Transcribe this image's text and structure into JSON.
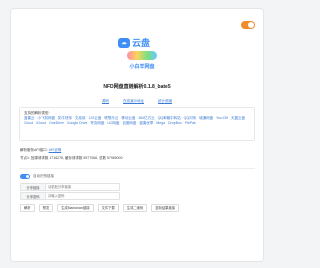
{
  "logo": {
    "brand": "云盘",
    "tagline": "小白羊网盘"
  },
  "title": "NFD网盘直链解析0.1.8_bate5",
  "links": [
    "源码",
    "在线演示地址",
    "统计频道"
  ],
  "sites": {
    "header": "支持的解析类型:",
    "items": [
      "蓝奏云",
      "小飞机网盘",
      "奶牛快传",
      "文叔叔",
      "123云盘",
      "联想乐云",
      "移动云盘",
      "360亿方云",
      "QQ邮箱中转站",
      "QQ闪传",
      "城通网盘",
      "Yun139",
      "天翼云盘",
      "Cloud",
      "iCloud",
      "OneDrive",
      "Google Drive",
      "夸克网盘",
      "UC网盘",
      "百度网盘",
      "蓝奏优享",
      "Mega",
      "DropBox",
      "PikPak"
    ]
  },
  "api": {
    "prefix": "解析服务API接口: ",
    "link": "API说明"
  },
  "stats": "节点1: 回源请求数 1716278, 缓存请求数 5577066, 总数 57969000",
  "switch_label": "自动识别链接",
  "fields": {
    "share_label": "分享链接",
    "share_placeholder": "请粘贴分享链接",
    "pwd_label": "分享密码",
    "pwd_placeholder": "请输入密码"
  },
  "buttons": [
    "解析",
    "预览",
    "生成Markdown链接",
    "文件下载",
    "生成二维码",
    "复制结果链接"
  ]
}
